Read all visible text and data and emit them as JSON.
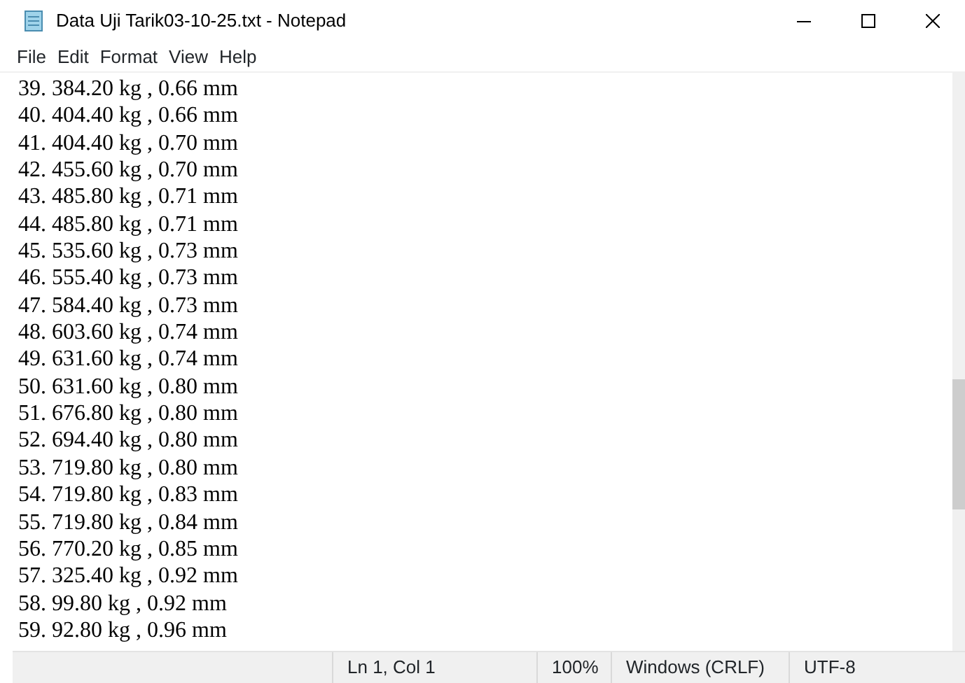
{
  "window": {
    "title": "Data Uji Tarik03-10-25.txt - Notepad"
  },
  "menu": [
    "File",
    "Edit",
    "Format",
    "View",
    "Help"
  ],
  "lines": [
    "39. 384.20 kg , 0.66 mm",
    "40. 404.40 kg , 0.66 mm",
    "41. 404.40 kg , 0.70 mm",
    "42. 455.60 kg , 0.70 mm",
    "43. 485.80 kg , 0.71 mm",
    "44. 485.80 kg , 0.71 mm",
    "45. 535.60 kg , 0.73 mm",
    "46. 555.40 kg , 0.73 mm",
    "47. 584.40 kg , 0.73 mm",
    "48. 603.60 kg , 0.74 mm",
    "49. 631.60 kg , 0.74 mm",
    "50. 631.60 kg , 0.80 mm",
    "51. 676.80 kg , 0.80 mm",
    "52. 694.40 kg , 0.80 mm",
    "53. 719.80 kg , 0.80 mm",
    "54. 719.80 kg , 0.83 mm",
    "55. 719.80 kg , 0.84 mm",
    "56. 770.20 kg , 0.85 mm",
    "57. 325.40 kg , 0.92 mm",
    "58. 99.80 kg , 0.92 mm",
    "59. 92.80 kg , 0.96 mm"
  ],
  "status_bar": [
    "Ln 1, Col 1",
    "100%",
    "Windows (CRLF)",
    "UTF-8"
  ]
}
